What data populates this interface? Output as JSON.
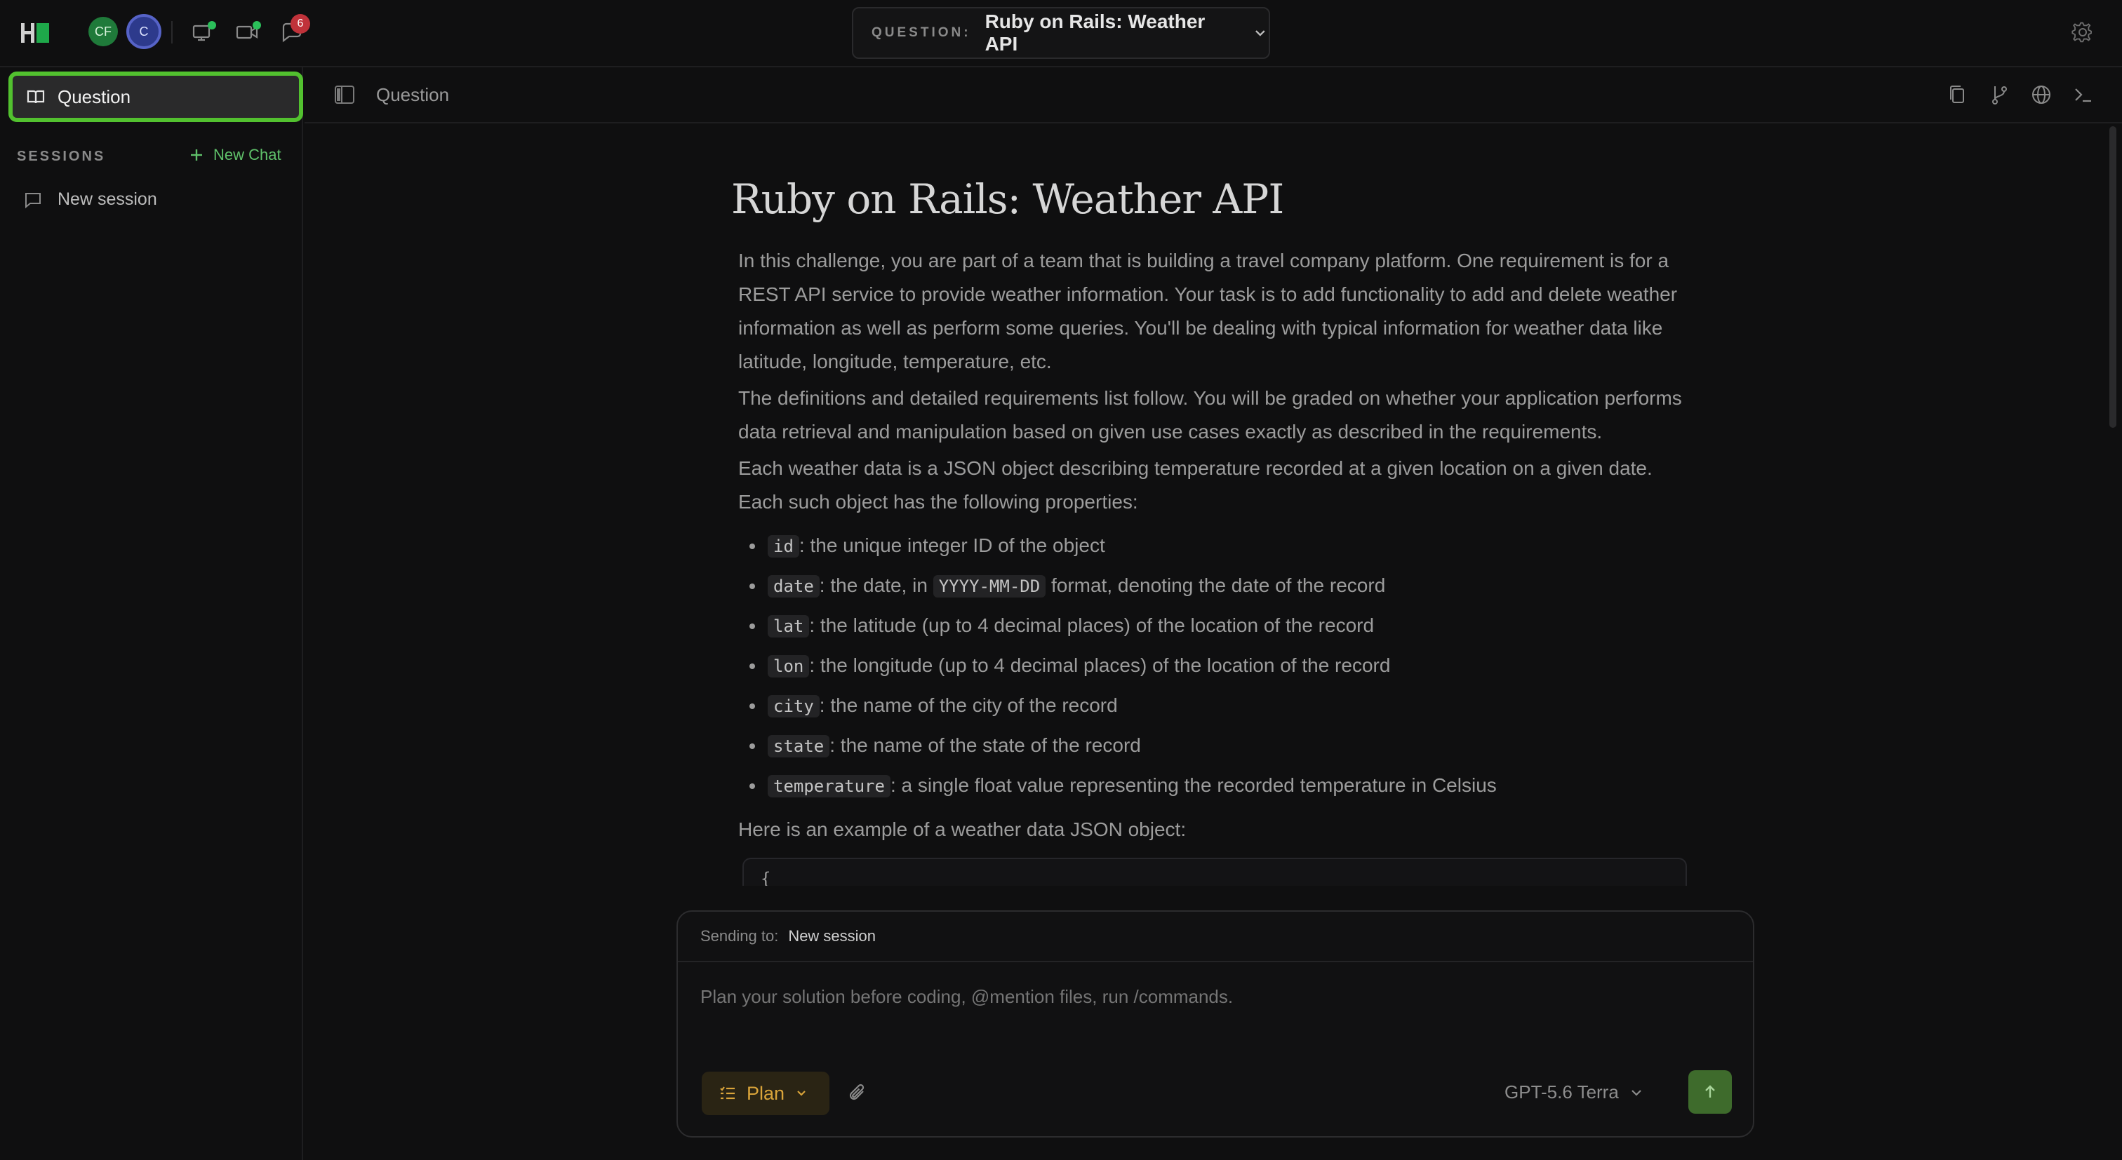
{
  "topbar": {
    "logo_icon": "hackerrank-logo",
    "avatars": [
      "CF",
      "C"
    ],
    "notification_count": "6",
    "question_label": "QUESTION:",
    "question_title": "Ruby on Rails: Weather API"
  },
  "sidebar": {
    "active_item": "Question",
    "sessions_label": "SESSIONS",
    "new_chat_label": "New Chat",
    "sessions": [
      "New session"
    ]
  },
  "main_header": {
    "title": "Question"
  },
  "document": {
    "title": "Ruby on Rails: Weather API",
    "intro": "In this challenge, you are part of a team that is building a travel company platform. One requirement is for a REST API service to provide weather information. Your task is to add functionality to add and delete weather information as well as perform some queries. You'll be dealing with typical information for weather data like latitude, longitude, temperature, etc.",
    "definitions": "The definitions and detailed requirements list follow. You will be graded on whether your application performs data retrieval and manipulation based on given use cases exactly as described in the requirements.",
    "object_desc": "Each weather data is a JSON object describing temperature recorded at a given location on a given date. Each such object has the following properties:",
    "properties": [
      {
        "code": "id",
        "text": ": the unique integer ID of the object"
      },
      {
        "code": "date",
        "text_before": ": the date, in ",
        "code2": "YYYY-MM-DD",
        "text": " format, denoting the date of the record"
      },
      {
        "code": "lat",
        "text": ": the latitude (up to 4 decimal places) of the location of the record"
      },
      {
        "code": "lon",
        "text": ": the longitude (up to 4 decimal places) of the location of the record"
      },
      {
        "code": "city",
        "text": ": the name of the city of the record"
      },
      {
        "code": "state",
        "text": ": the name of the state of the record"
      },
      {
        "code": "temperature",
        "text": ": a single float value representing the recorded temperature in Celsius"
      }
    ],
    "example_label": "Here is an example of a weather data JSON object:",
    "code_start": "{"
  },
  "composer": {
    "sending_to_label": "Sending to:",
    "sending_to_value": "New session",
    "placeholder": "Plan your solution before coding, @mention files, run /commands.",
    "mode_label": "Plan",
    "model_label": "GPT-5.6 Terra"
  },
  "colors": {
    "background": "#0f0f10",
    "accent_green": "#52c12f",
    "plan_accent": "#d9a43a",
    "badge_red": "#c0323a"
  }
}
